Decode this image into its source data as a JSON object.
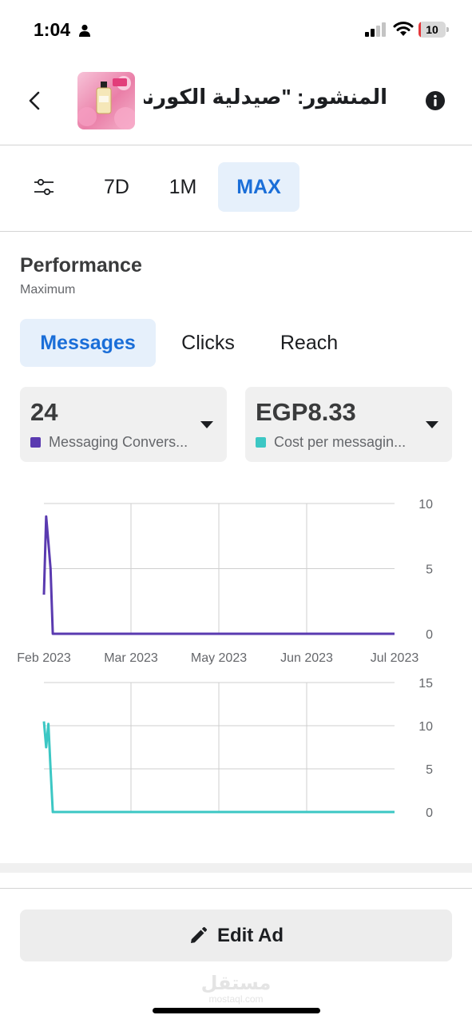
{
  "status_bar": {
    "time": "1:04",
    "battery_level": "10",
    "battery_fraction": 0.1,
    "person_icon": "person-icon",
    "signal_icon": "cellular-signal-icon",
    "wifi_icon": "wifi-icon"
  },
  "header": {
    "title": "المنشور: \"صيدلية الكورني..",
    "back_icon": "chevron-left-icon",
    "info_icon": "info-icon"
  },
  "date_filter": {
    "filter_icon": "sliders-icon",
    "ranges": [
      "7D",
      "1M",
      "MAX"
    ],
    "selected": "MAX"
  },
  "performance": {
    "title": "Performance",
    "subtitle": "Maximum",
    "tabs": [
      "Messages",
      "Clicks",
      "Reach"
    ],
    "selected_tab": "Messages"
  },
  "metrics": [
    {
      "value": "24",
      "label": "Messaging Convers...",
      "color": "#5a3ab0"
    },
    {
      "value": "EGP8.33",
      "label": "Cost per messagin...",
      "color": "#3cc7c4"
    }
  ],
  "chart_data": [
    {
      "type": "line",
      "series": [
        {
          "color": "#5a3ab0",
          "x": [
            "2023-01-24",
            "2023-01-25",
            "2023-01-26",
            "2023-01-27",
            "2023-01-28",
            "2023-02-01",
            "2023-03-01",
            "2023-04-01",
            "2023-05-01",
            "2023-06-01",
            "2023-07-01"
          ],
          "y": [
            3,
            9,
            7,
            5,
            0,
            0,
            0,
            0,
            0,
            0,
            0
          ]
        }
      ],
      "x_ticks": [
        "Feb 2023",
        "Mar 2023",
        "May 2023",
        "Jun 2023",
        "Jul 2023"
      ],
      "y_ticks": [
        "10",
        "5",
        "0"
      ],
      "ylim": [
        0,
        10
      ],
      "grid": true
    },
    {
      "type": "line",
      "series": [
        {
          "color": "#3cc7c4",
          "x": [
            "2023-01-24",
            "2023-01-25",
            "2023-01-26",
            "2023-01-27",
            "2023-01-28",
            "2023-02-01",
            "2023-03-01",
            "2023-04-01",
            "2023-05-01",
            "2023-06-01",
            "2023-07-01"
          ],
          "y": [
            10.5,
            7.5,
            10.2,
            5,
            0,
            0,
            0,
            0,
            0,
            0,
            0
          ]
        }
      ],
      "x_ticks": [],
      "y_ticks": [
        "15",
        "10",
        "5",
        "0"
      ],
      "ylim": [
        0,
        15
      ],
      "grid": true
    }
  ],
  "actions": {
    "edit_label": "Edit Ad",
    "edit_icon": "pencil-icon"
  },
  "watermark": {
    "arabic": "مستقل",
    "latin": "mostaql.com"
  }
}
